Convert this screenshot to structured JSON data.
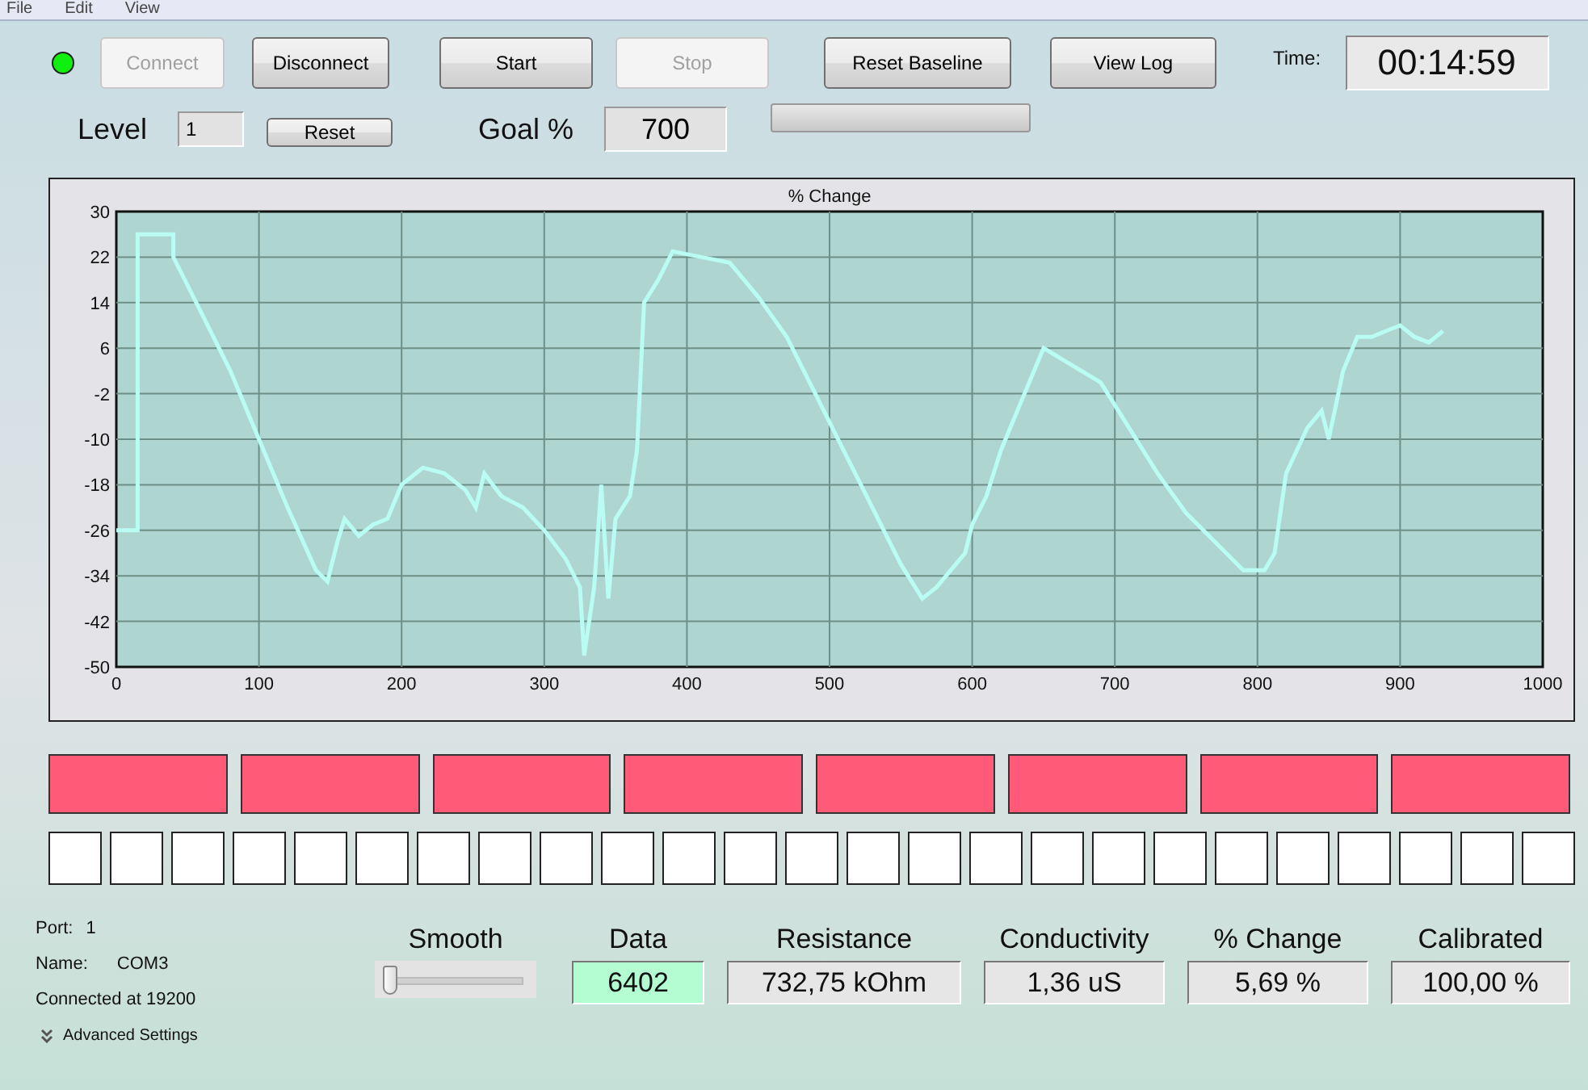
{
  "menu": [
    "File",
    "Edit",
    "View"
  ],
  "connection_led": {
    "on": true
  },
  "buttons": [
    {
      "label": "Connect",
      "disabled": true
    },
    {
      "label": "Disconnect",
      "disabled": false
    },
    {
      "label": "Start",
      "disabled": false
    },
    {
      "label": "Stop",
      "disabled": true
    },
    {
      "label": "Reset Baseline",
      "disabled": false
    },
    {
      "label": "View Log",
      "disabled": false
    }
  ],
  "time": {
    "label": "Time:",
    "value": "00:14:59"
  },
  "level": {
    "label": "Level",
    "value": "1",
    "reset_button": "Reset"
  },
  "goal": {
    "label": "Goal %",
    "value": "700"
  },
  "goal_progress": {
    "level": 0
  },
  "chart": {
    "chart_data": {
      "type": "line",
      "title": "% Change",
      "x": [
        0,
        15,
        15,
        40,
        40,
        60,
        80,
        100,
        120,
        140,
        148,
        155,
        160,
        170,
        180,
        190,
        200,
        215,
        230,
        245,
        252,
        258,
        270,
        285,
        300,
        315,
        325,
        328,
        335,
        340,
        345,
        350,
        360,
        365,
        370,
        380,
        390,
        410,
        430,
        450,
        470,
        490,
        510,
        530,
        550,
        565,
        575,
        585,
        595,
        600,
        610,
        620,
        630,
        640,
        650,
        670,
        690,
        710,
        730,
        750,
        770,
        790,
        805,
        812,
        820,
        835,
        845,
        850,
        860,
        870,
        880,
        890,
        900,
        910,
        920,
        930
      ],
      "series": [
        {
          "color": "#b8fcf4",
          "values": [
            -26,
            -26,
            26,
            26,
            22,
            12,
            2,
            -10,
            -22,
            -33,
            -35,
            -28,
            -24,
            -27,
            -25,
            -24,
            -18,
            -15,
            -16,
            -19,
            -22,
            -16,
            -20,
            -22,
            -26,
            -31,
            -36,
            -48,
            -36,
            -18,
            -38,
            -24,
            -20,
            -12,
            14,
            18,
            23,
            22,
            21,
            15,
            8,
            -2,
            -12,
            -22,
            -32,
            -38,
            -36,
            -33,
            -30,
            -25,
            -20,
            -12,
            -6,
            0,
            6,
            3,
            0,
            -8,
            -16,
            -23,
            -28,
            -33,
            -33,
            -30,
            -16,
            -8,
            -5,
            -10,
            2,
            8,
            8,
            9,
            10,
            8,
            7,
            9
          ]
        }
      ],
      "grid": true,
      "xlim": [
        0,
        1000
      ],
      "ylim": [
        -50,
        30
      ],
      "xticks": [
        0,
        100,
        200,
        300,
        400,
        500,
        600,
        700,
        800,
        900,
        1000
      ],
      "yticks": [
        -50,
        -42,
        -34,
        -26,
        -18,
        -10,
        -2,
        6,
        14,
        22,
        30
      ]
    }
  },
  "indicator_bars": [
    {
      "on": true
    },
    {
      "on": true
    },
    {
      "on": true
    },
    {
      "on": true
    },
    {
      "on": true
    },
    {
      "on": true
    },
    {
      "on": true
    },
    {
      "on": true
    }
  ],
  "indicator_cells": [
    {
      "on": false
    },
    {
      "on": false
    },
    {
      "on": false
    },
    {
      "on": false
    },
    {
      "on": false
    },
    {
      "on": false
    },
    {
      "on": false
    },
    {
      "on": false
    },
    {
      "on": false
    },
    {
      "on": false
    },
    {
      "on": false
    },
    {
      "on": false
    },
    {
      "on": false
    },
    {
      "on": false
    },
    {
      "on": false
    },
    {
      "on": false
    },
    {
      "on": false
    },
    {
      "on": false
    },
    {
      "on": false
    },
    {
      "on": false
    },
    {
      "on": false
    },
    {
      "on": false
    },
    {
      "on": false
    },
    {
      "on": false
    },
    {
      "on": false
    }
  ],
  "port_info": {
    "port_label": "Port:",
    "port": "1",
    "name_label": "Name:",
    "name": "COM3",
    "status": "Connected at 19200",
    "advanced_settings": "Advanced Settings"
  },
  "smooth": {
    "label": "Smooth",
    "level": 0
  },
  "readouts": [
    {
      "label": "Data",
      "value": "6402",
      "highlighted": true
    },
    {
      "label": "Resistance",
      "value": "732,75 kOhm",
      "highlighted": false
    },
    {
      "label": "Conductivity",
      "value": "1,36 uS",
      "highlighted": false
    },
    {
      "label": "% Change",
      "value": "5,69 %",
      "highlighted": false
    },
    {
      "label": "Calibrated",
      "value": "100,00 %",
      "highlighted": false
    }
  ]
}
